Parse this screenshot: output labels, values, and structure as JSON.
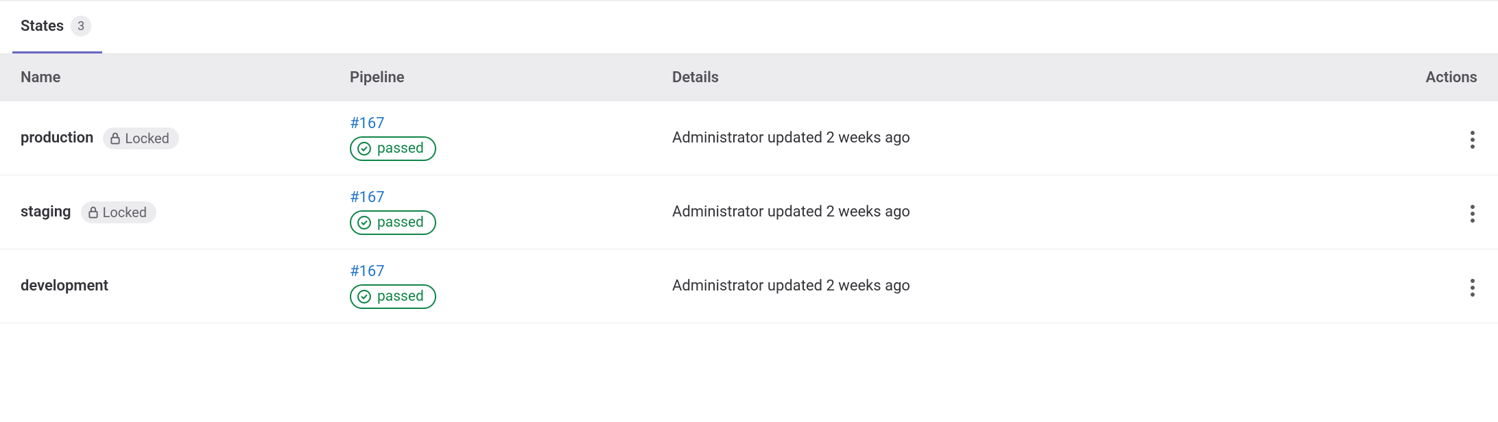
{
  "tab": {
    "label": "States",
    "count": "3"
  },
  "columns": {
    "name": "Name",
    "pipeline": "Pipeline",
    "details": "Details",
    "actions": "Actions"
  },
  "badges": {
    "locked": "Locked",
    "passed": "passed"
  },
  "rows": [
    {
      "name": "production",
      "locked": true,
      "pipeline_id": "#167",
      "status": "passed",
      "details": "Administrator updated 2 weeks ago"
    },
    {
      "name": "staging",
      "locked": true,
      "pipeline_id": "#167",
      "status": "passed",
      "details": "Administrator updated 2 weeks ago"
    },
    {
      "name": "development",
      "locked": false,
      "pipeline_id": "#167",
      "status": "passed",
      "details": "Administrator updated 2 weeks ago"
    }
  ]
}
